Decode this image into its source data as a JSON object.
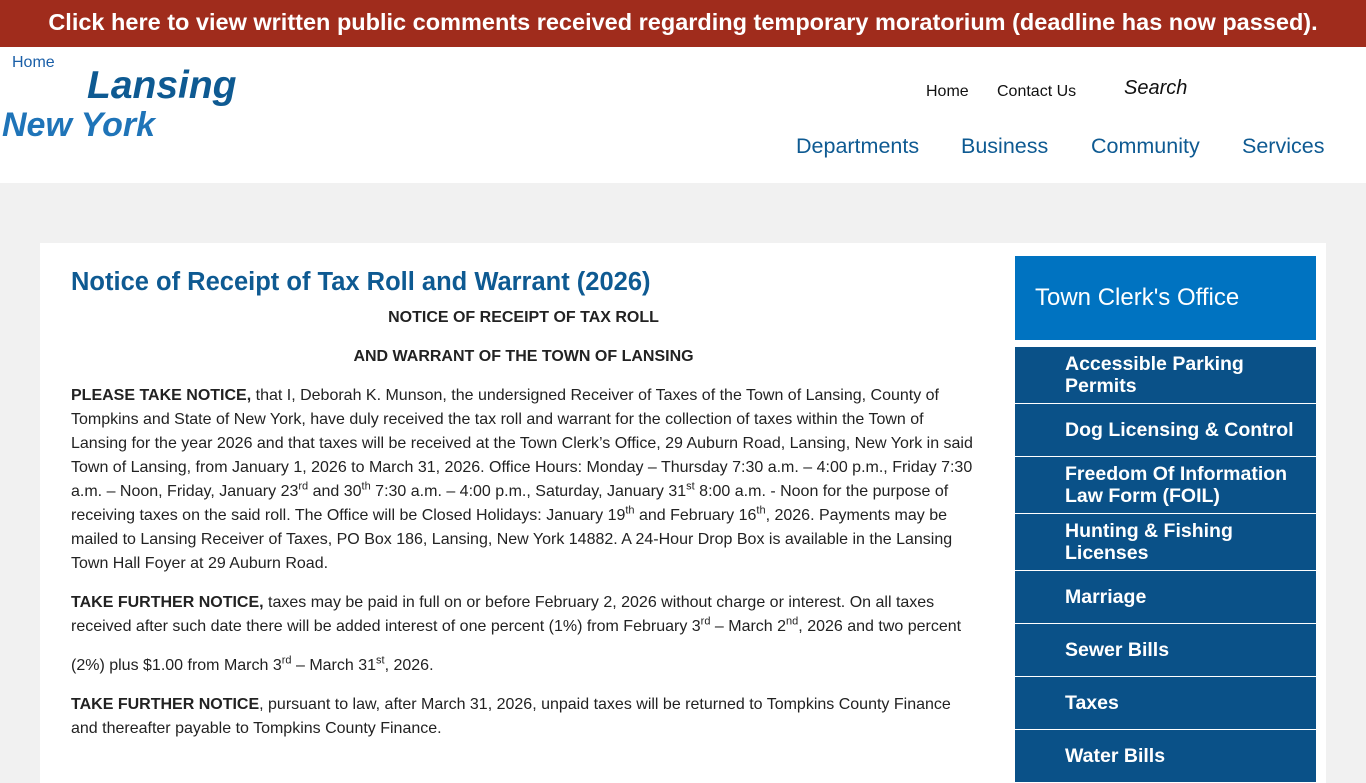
{
  "banner": {
    "text": "Click here to view written public comments received regarding temporary moratorium (deadline has now passed)."
  },
  "header": {
    "logo_alt": "Home",
    "logo_line1": "Lansing",
    "logo_line2": "New York",
    "util_links": [
      "Home",
      "Contact Us"
    ],
    "search_placeholder": "Search",
    "nav": [
      "Departments",
      "Business",
      "Community",
      "Services"
    ]
  },
  "article": {
    "title": "Notice of Receipt of Tax Roll and Warrant (2026)",
    "heading1": "NOTICE OF RECEIPT OF TAX ROLL",
    "heading2": "AND WARRANT OF THE TOWN OF LANSING",
    "p1": {
      "lead": "PLEASE TAKE NOTICE,",
      "t1": " that I, Deborah K. Munson, the undersigned Receiver of Taxes of the Town of Lansing, County of Tompkins and State of New York, have duly received the tax roll and warrant for the collection of taxes within the Town of Lansing for the year 2026 and that taxes will be received at the Town Clerk’s Office, 29 Auburn Road, Lansing, New York in said Town of Lansing, from January 1, 2026 to March 31, 2026. Office Hours: Monday – Thursday 7:30 a.m. – 4:00 p.m., Friday 7:30 a.m. – Noon, Friday, January 23",
      "s1": "rd",
      "t2": " and 30",
      "s2": "th",
      "t3": " 7:30 a.m. – 4:00 p.m., Saturday, January 31",
      "s3": "st",
      "t4": " 8:00 a.m. - Noon for the purpose of receiving taxes on the said roll. The Office will be Closed Holidays: January 19",
      "s4": "th",
      "t5": " and February 16",
      "s5": "th",
      "t6": ", 2026. Payments may be mailed to Lansing Receiver of Taxes, PO Box 186, Lansing, New York 14882. A 24-Hour Drop Box is available in the Lansing Town Hall Foyer at 29 Auburn Road."
    },
    "p2": {
      "lead": "TAKE FURTHER NOTICE,",
      "t1": " taxes may be paid in full on or before February 2, 2026 without charge or interest. On all taxes received after such date there will be added interest of one percent (1%) from February 3",
      "s1": "rd",
      "t2": " – March 2",
      "s2": "nd",
      "t3": ", 2026 and two percent"
    },
    "p3": {
      "t1": "(2%) plus $1.00 from March 3",
      "s1": "rd",
      "t2": " – March 31",
      "s2": "st",
      "t3": ", 2026."
    },
    "p4": {
      "lead": "TAKE FURTHER NOTICE",
      "t1": ", pursuant to law, after March 31, 2026, unpaid taxes will be returned to Tompkins County Finance and thereafter payable to Tompkins County Finance."
    }
  },
  "sidebar": {
    "title": "Town Clerk's Office",
    "items": [
      "Accessible Parking Permits",
      "Dog Licensing & Control",
      "Freedom Of Information Law Form (FOIL)",
      "Hunting & Fishing Licenses",
      "Marriage",
      "Sewer Bills",
      "Taxes",
      "Water Bills"
    ]
  }
}
